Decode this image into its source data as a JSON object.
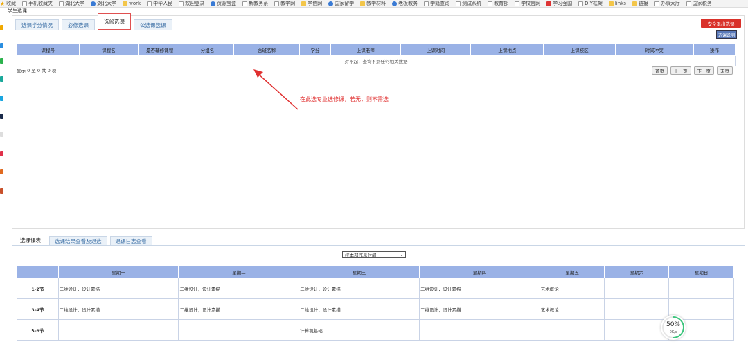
{
  "bookmarks": [
    {
      "label": "收藏",
      "icon": "star-icon"
    },
    {
      "label": "手机收藏夹",
      "icon": "page-icon"
    },
    {
      "label": "湖北大学",
      "icon": "page-icon"
    },
    {
      "label": "湖北大学",
      "icon": "globe-icon"
    },
    {
      "label": "work",
      "icon": "folder-icon"
    },
    {
      "label": "中华人民",
      "icon": "page-icon"
    },
    {
      "label": "欢迎登录",
      "icon": "page-icon"
    },
    {
      "label": "资源宝盒",
      "icon": "globe-icon"
    },
    {
      "label": "新教务系",
      "icon": "page-icon"
    },
    {
      "label": "教学网",
      "icon": "page-icon"
    },
    {
      "label": "学信网",
      "icon": "folder-icon"
    },
    {
      "label": "国家留学",
      "icon": "globe-icon"
    },
    {
      "label": "教学材料",
      "icon": "folder-icon"
    },
    {
      "label": "老板教务",
      "icon": "globe-icon"
    },
    {
      "label": "学籍查询",
      "icon": "page-icon"
    },
    {
      "label": "测试系统",
      "icon": "page-icon"
    },
    {
      "label": "教育部",
      "icon": "page-icon"
    },
    {
      "label": "学校官网",
      "icon": "page-icon"
    },
    {
      "label": "学习强国",
      "icon": "red-icon"
    },
    {
      "label": "DIY框架",
      "icon": "page-icon"
    },
    {
      "label": "links",
      "icon": "folder-icon"
    },
    {
      "label": "链接",
      "icon": "folder-icon"
    },
    {
      "label": "办事大厅",
      "icon": "page-icon"
    },
    {
      "label": "国家税务",
      "icon": "page-icon"
    }
  ],
  "page_title": "学生选课",
  "top_tabs": [
    "选课学分情况",
    "必修选课",
    "选修选课",
    "公选课选课"
  ],
  "exit_button": "安全退出选课",
  "guide_button": "选课说明",
  "course_table": {
    "headers": [
      "课程号",
      "课程名",
      "是否辅修课程",
      "分组名",
      "合班名称",
      "学分",
      "上课老师",
      "上课时间",
      "上课地点",
      "上课校区",
      "时间冲突",
      "操作"
    ],
    "empty_message": "对不起，查询不到任何相关数据"
  },
  "showing": "显示 0 至 0 共 0 项",
  "pager": [
    "首页",
    "上一页",
    "下一页",
    "末页"
  ],
  "annotation": "在此选专业选修课，若无，则不需选",
  "bottom_tabs": [
    "选课课表",
    "选课结果查看及退选",
    "退课日志查看"
  ],
  "campus_select": "校本部作息时间",
  "schedule": {
    "days": [
      "星期一",
      "星期二",
      "星期三",
      "星期四",
      "星期五",
      "星期六",
      "星期日"
    ],
    "rows": [
      {
        "period": "1-2节",
        "cells": [
          "二维设计，设计素描",
          "二维设计，设计素描",
          "二维设计，设计素描",
          "二维设计，设计素描",
          "艺术概论",
          "",
          ""
        ]
      },
      {
        "period": "3-4节",
        "cells": [
          "二维设计，设计素描",
          "二维设计，设计素描",
          "二维设计，设计素描",
          "二维设计，设计素描",
          "艺术概论",
          "",
          ""
        ]
      },
      {
        "period": "5-6节",
        "cells": [
          "",
          "",
          "计算机基础",
          "",
          "",
          "",
          ""
        ]
      }
    ]
  },
  "speed_gauge": {
    "percent": "50%",
    "rate": "0K/s"
  },
  "colors": {
    "header_blue": "#9ab2e6",
    "exit_red": "#d9312a",
    "annotation_red": "#e03030",
    "gauge_green": "#3cc47c"
  }
}
